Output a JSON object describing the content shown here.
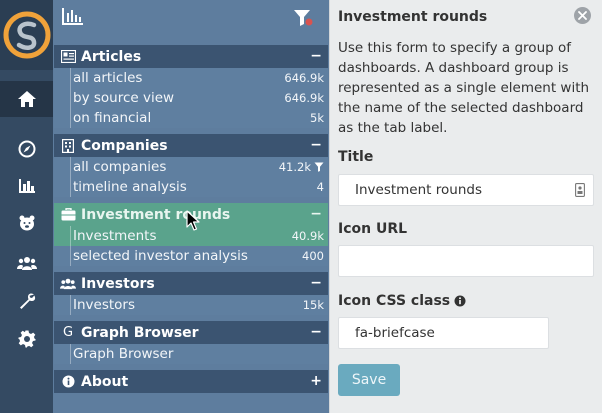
{
  "nav": {
    "sections": [
      {
        "title": "Articles",
        "icon": "newspaper-icon",
        "toggle": "−",
        "items": [
          {
            "label": "all articles",
            "count": "646.9k"
          },
          {
            "label": "by source view",
            "count": "646.9k"
          },
          {
            "label": "on financial",
            "count": "5k"
          }
        ]
      },
      {
        "title": "Companies",
        "icon": "building-icon",
        "toggle": "−",
        "items": [
          {
            "label": "all companies",
            "count": "41.2k"
          },
          {
            "label": "timeline analysis",
            "count": "4"
          }
        ]
      },
      {
        "title": "Investment rounds",
        "icon": "briefcase-icon",
        "toggle": "−",
        "items": [
          {
            "label": "Investments",
            "count": "40.9k"
          },
          {
            "label": "selected investor analysis",
            "count": "400"
          }
        ]
      },
      {
        "title": "Investors",
        "icon": "users-icon",
        "toggle": "−",
        "items": [
          {
            "label": "Investors",
            "count": "15k"
          }
        ]
      },
      {
        "title": "Graph Browser",
        "icon": "letter-g-icon",
        "icon_glyph": "G",
        "toggle": "−",
        "items": [
          {
            "label": "Graph Browser",
            "count": ""
          }
        ]
      },
      {
        "title": "About",
        "icon": "info-circle-icon",
        "toggle": "+",
        "items": []
      }
    ]
  },
  "form": {
    "title": "Investment rounds",
    "description": "Use this form to specify a group of dashboards. A dashboard group is represented as a single element with the name of the selected dashboard as the tab label.",
    "fields": {
      "title_label": "Title",
      "title_value": "Investment rounds",
      "icon_url_label": "Icon URL",
      "icon_url_value": "",
      "icon_css_label": "Icon CSS class",
      "icon_css_value": "fa-briefcase"
    },
    "save_label": "Save"
  },
  "colors": {
    "rail": "#344a62",
    "nav": "#5e7d9e",
    "section_header": "#3b5471",
    "highlight": "#5aa38c",
    "save_button": "#6aaabf",
    "logo_orange": "#f0a23a"
  }
}
